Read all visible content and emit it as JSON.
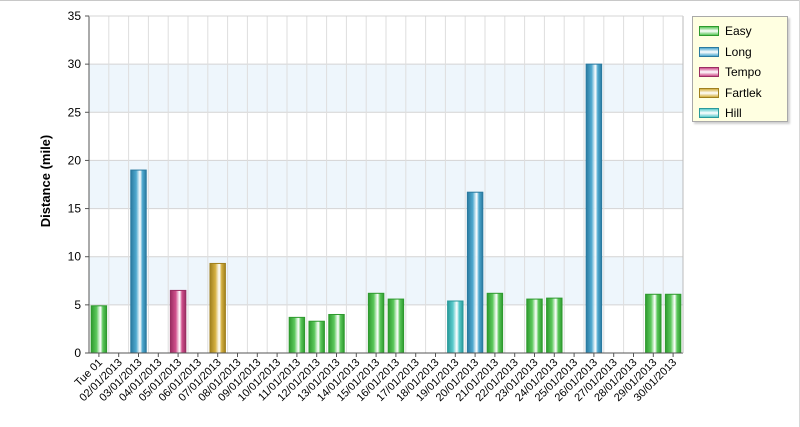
{
  "chart_data": {
    "type": "bar",
    "ylabel": "Distance (mile)",
    "xlabel": "",
    "ylim": [
      0,
      35
    ],
    "yticks": [
      0,
      5,
      10,
      15,
      20,
      25,
      30,
      35
    ],
    "grid": true,
    "legend_position": "top-right",
    "categories": [
      "Tue 01",
      "02/01/2013",
      "03/01/2013",
      "04/01/2013",
      "05/01/2013",
      "06/01/2013",
      "07/01/2013",
      "08/01/2013",
      "09/01/2013",
      "10/01/2013",
      "11/01/2013",
      "12/01/2013",
      "13/01/2013",
      "14/01/2013",
      "15/01/2013",
      "16/01/2013",
      "17/01/2013",
      "18/01/2013",
      "19/01/2013",
      "20/01/2013",
      "21/01/2013",
      "22/01/2013",
      "23/01/2013",
      "24/01/2013",
      "25/01/2013",
      "26/01/2013",
      "27/01/2013",
      "28/01/2013",
      "29/01/2013",
      "30/01/2013"
    ],
    "series": [
      {
        "name": "Easy",
        "color": "#5cc85c",
        "stroke": "#2e9a2e",
        "values": [
          4.9,
          null,
          null,
          null,
          null,
          null,
          null,
          null,
          null,
          null,
          3.7,
          3.3,
          4.0,
          null,
          6.2,
          5.6,
          null,
          null,
          null,
          null,
          6.2,
          null,
          5.6,
          5.7,
          null,
          null,
          null,
          null,
          6.1,
          6.1
        ]
      },
      {
        "name": "Long",
        "color": "#4fa9cf",
        "stroke": "#2a7aa0",
        "values": [
          null,
          null,
          19.0,
          null,
          null,
          null,
          null,
          null,
          null,
          null,
          null,
          null,
          null,
          null,
          null,
          null,
          null,
          null,
          null,
          16.7,
          null,
          null,
          null,
          null,
          null,
          30.0,
          null,
          null,
          null,
          null
        ]
      },
      {
        "name": "Tempo",
        "color": "#d0508c",
        "stroke": "#9a2e62",
        "values": [
          null,
          null,
          null,
          null,
          6.5,
          null,
          null,
          null,
          null,
          null,
          null,
          null,
          null,
          null,
          null,
          null,
          null,
          null,
          null,
          null,
          null,
          null,
          null,
          null,
          null,
          null,
          null,
          null,
          null,
          null
        ]
      },
      {
        "name": "Fartlek",
        "color": "#d4b040",
        "stroke": "#a0801e",
        "values": [
          null,
          null,
          null,
          null,
          null,
          null,
          9.3,
          null,
          null,
          null,
          null,
          null,
          null,
          null,
          null,
          null,
          null,
          null,
          null,
          null,
          null,
          null,
          null,
          null,
          null,
          null,
          null,
          null,
          null,
          null
        ]
      },
      {
        "name": "Hill",
        "color": "#5acbcc",
        "stroke": "#2a9a9b",
        "values": [
          null,
          null,
          null,
          null,
          null,
          null,
          null,
          null,
          null,
          null,
          null,
          null,
          null,
          null,
          null,
          null,
          null,
          null,
          5.4,
          null,
          null,
          null,
          null,
          null,
          null,
          null,
          null,
          null,
          null,
          null
        ]
      }
    ]
  }
}
